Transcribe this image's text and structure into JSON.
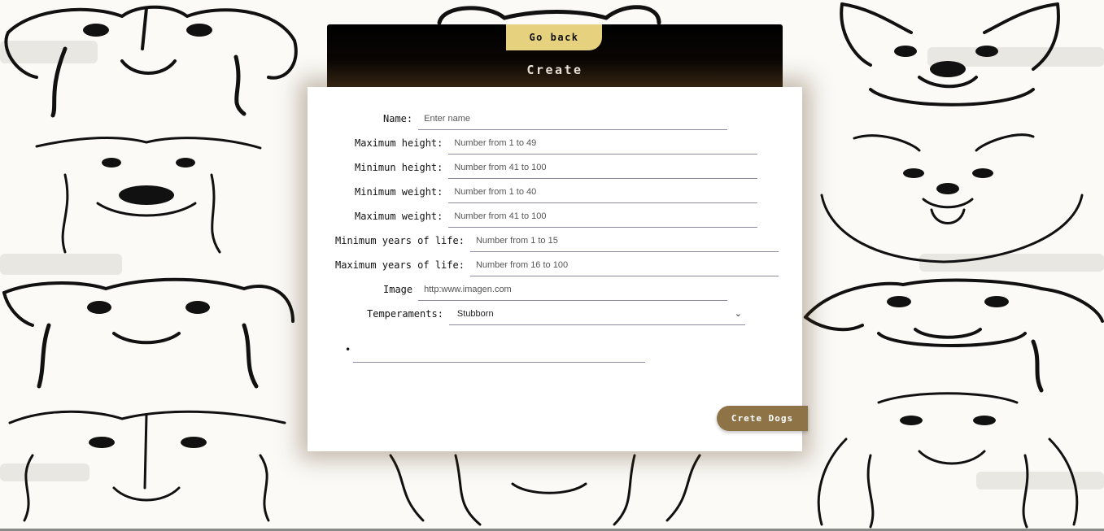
{
  "header": {
    "back_label": "Go back",
    "title": "Create"
  },
  "form": {
    "name": {
      "label": "Name:",
      "placeholder": "Enter name"
    },
    "max_height": {
      "label": "Maximum height:",
      "placeholder": "Number from 1 to 49"
    },
    "min_height": {
      "label": "Minimun height:",
      "placeholder": "Number from 41 to 100"
    },
    "min_weight": {
      "label": "Minimum weight:",
      "placeholder": "Number from 1 to 40"
    },
    "max_weight": {
      "label": "Maximum weight:",
      "placeholder": "Number from 41 to 100"
    },
    "min_life": {
      "label": "Minimum years of life:",
      "placeholder": "Number from 1 to 15"
    },
    "max_life": {
      "label": "Maximum years of life:",
      "placeholder": "Number from 16 to 100"
    },
    "image": {
      "label": "Image",
      "placeholder": "http:www.imagen.com"
    },
    "temperaments": {
      "label": "Temperaments:",
      "selected": "Stubborn",
      "icon": "chevron-down-icon"
    },
    "selected_temperaments": [
      ""
    ],
    "submit_label": "Crete Dogs"
  },
  "colors": {
    "back_button": "#e6d27e",
    "submit_button": "#8d7345",
    "header": "#000000"
  }
}
